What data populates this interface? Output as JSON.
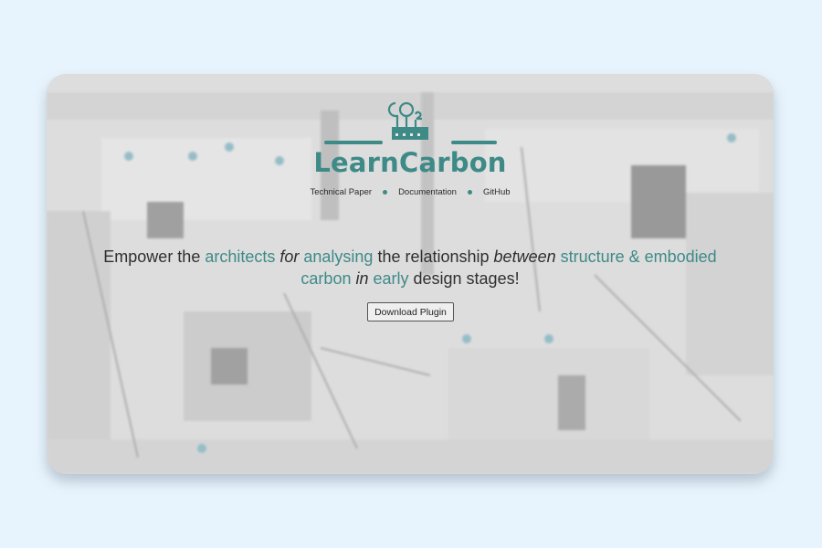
{
  "brand": {
    "name": "LearnCarbon",
    "logo_text": "CO2",
    "accent_color": "#3e8a87"
  },
  "nav": {
    "items": [
      "Technical Paper",
      "Documentation",
      "GitHub"
    ]
  },
  "hero": {
    "segments": [
      {
        "text": "Empower the ",
        "style": "plain"
      },
      {
        "text": "architects ",
        "style": "accent"
      },
      {
        "text": "for ",
        "style": "italic"
      },
      {
        "text": "analysing ",
        "style": "accent"
      },
      {
        "text": "the relationship ",
        "style": "plain"
      },
      {
        "text": "between ",
        "style": "italic"
      },
      {
        "text": "structure & embodied carbon ",
        "style": "accent"
      },
      {
        "text": "in ",
        "style": "italic"
      },
      {
        "text": "early ",
        "style": "accent"
      },
      {
        "text": "design stages!",
        "style": "plain"
      }
    ],
    "cta_label": "Download Plugin"
  },
  "background": {
    "description_icon": "construction-site-photo"
  }
}
